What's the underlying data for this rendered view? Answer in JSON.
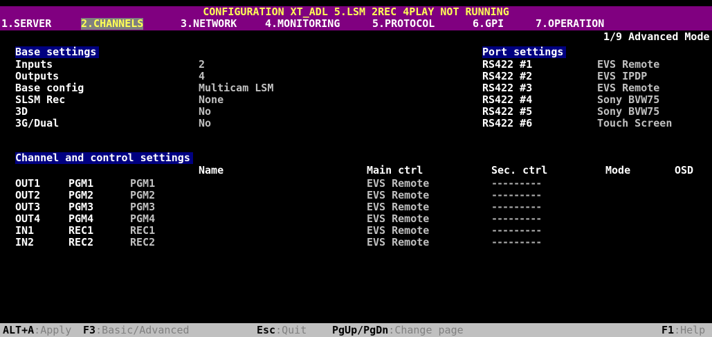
{
  "title": "CONFIGURATION XT_ADL 5.LSM  2REC 4PLAY NOT RUNNING",
  "menu": [
    {
      "label": "1.SERVER"
    },
    {
      "label": "2.CHANNELS"
    },
    {
      "label": "3.NETWORK"
    },
    {
      "label": "4.MONITORING"
    },
    {
      "label": "5.PROTOCOL"
    },
    {
      "label": "6.GPI"
    },
    {
      "label": "7.OPERATION"
    }
  ],
  "page_indicator": "1/9 Advanced Mode",
  "base": {
    "title": "Base settings",
    "rows": [
      {
        "label": "Inputs",
        "value": "2"
      },
      {
        "label": "Outputs",
        "value": "4"
      },
      {
        "label": "Base config",
        "value": "Multicam LSM"
      },
      {
        "label": "SLSM Rec",
        "value": "None"
      },
      {
        "label": "3D",
        "value": "No"
      },
      {
        "label": "3G/Dual",
        "value": "No"
      }
    ]
  },
  "ports": {
    "title": "Port settings",
    "rows": [
      {
        "port": "RS422 #1",
        "value": "EVS Remote"
      },
      {
        "port": "RS422 #2",
        "value": "EVS IPDP"
      },
      {
        "port": "RS422 #3",
        "value": "EVS Remote"
      },
      {
        "port": "RS422 #4",
        "value": "Sony BVW75"
      },
      {
        "port": "RS422 #5",
        "value": "Sony BVW75"
      },
      {
        "port": "RS422 #6",
        "value": "Touch Screen"
      }
    ]
  },
  "channels": {
    "title": "Channel and control settings",
    "headers": {
      "name": "Name",
      "main": "Main ctrl",
      "sec": "Sec. ctrl",
      "mode": "Mode",
      "osd": "OSD"
    },
    "rows": [
      {
        "id": "OUT1",
        "type": "PGM1",
        "name": "PGM1",
        "main": "EVS Remote",
        "sec": "---------"
      },
      {
        "id": "OUT2",
        "type": "PGM2",
        "name": "PGM2",
        "main": "EVS Remote",
        "sec": "---------"
      },
      {
        "id": "OUT3",
        "type": "PGM3",
        "name": "PGM3",
        "main": "EVS Remote",
        "sec": "---------"
      },
      {
        "id": "OUT4",
        "type": "PGM4",
        "name": "PGM4",
        "main": "EVS Remote",
        "sec": "---------"
      },
      {
        "id": "IN1",
        "type": "REC1",
        "name": "REC1",
        "main": "EVS Remote",
        "sec": "---------"
      },
      {
        "id": "IN2",
        "type": "REC2",
        "name": "REC2",
        "main": "EVS Remote",
        "sec": "---------"
      }
    ]
  },
  "status": [
    {
      "key": "ALT+A",
      "desc": "Apply"
    },
    {
      "key": "F3",
      "desc": "Basic/Advanced"
    },
    {
      "key": "Esc",
      "desc": "Quit"
    },
    {
      "key": "PgUp/PgDn",
      "desc": "Change page"
    },
    {
      "key": "F1",
      "desc": "Help"
    }
  ],
  "colors": {
    "title_bg": "#800080",
    "title_fg": "#ffff55",
    "section_bg": "#000080",
    "status_bg": "#c0c0c0"
  }
}
